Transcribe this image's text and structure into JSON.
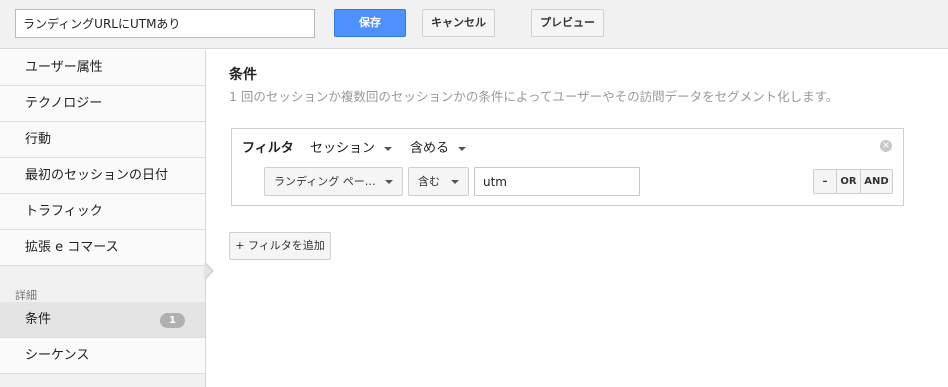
{
  "header": {
    "segment_name_value": "ランディングURLにUTMあり",
    "save_label": "保存",
    "cancel_label": "キャンセル",
    "preview_label": "プレビュー"
  },
  "sidebar": {
    "items": [
      {
        "label": "ユーザー属性"
      },
      {
        "label": "テクノロジー"
      },
      {
        "label": "行動"
      },
      {
        "label": "最初のセッションの日付"
      },
      {
        "label": "トラフィック"
      },
      {
        "label": "拡張 e コマース"
      }
    ],
    "advanced_heading": "詳細",
    "advanced_items": [
      {
        "label": "条件",
        "badge": "1"
      },
      {
        "label": "シーケンス"
      }
    ]
  },
  "main": {
    "title": "条件",
    "description": "1 回のセッションか複数回のセッションかの条件によってユーザーやその訪問データをセグメント化します。",
    "filter": {
      "label": "フィルタ",
      "scope": "セッション",
      "mode": "含める",
      "close_icon": "close-icon",
      "dimension": "ランディング ペー…",
      "operator": "含む",
      "value": "utm",
      "logic": {
        "remove": "–",
        "or": "OR",
        "and": "AND"
      }
    },
    "add_filter_label": "+ フィルタを追加"
  },
  "colors": {
    "primary": "#4d90fe",
    "sidebar_bg": "#f1f1f1",
    "badge": "#b0b0b0"
  }
}
